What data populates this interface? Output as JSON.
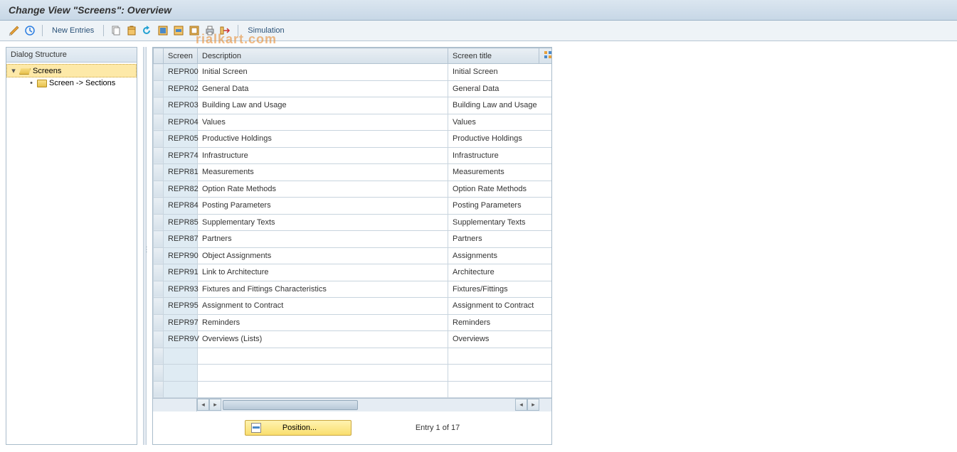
{
  "header": {
    "title": "Change View \"Screens\": Overview"
  },
  "toolbar": {
    "new_entries": "New Entries",
    "simulation": "Simulation"
  },
  "tree": {
    "header": "Dialog Structure",
    "items": [
      {
        "label": "Screens",
        "expanded": true,
        "selected": true,
        "icon": "folder-open"
      },
      {
        "label": "Screen -> Sections",
        "expanded": false,
        "selected": false,
        "icon": "folder-closed",
        "child": true
      }
    ]
  },
  "table": {
    "columns": [
      "Screen",
      "Description",
      "Screen title"
    ],
    "rows": [
      {
        "screen": "REPR00",
        "desc": "Initial Screen",
        "title": "Initial Screen"
      },
      {
        "screen": "REPR02",
        "desc": "General Data",
        "title": "General Data"
      },
      {
        "screen": "REPR03",
        "desc": "Building Law and Usage",
        "title": "Building Law and Usage"
      },
      {
        "screen": "REPR04",
        "desc": "Values",
        "title": "Values"
      },
      {
        "screen": "REPR05",
        "desc": "Productive Holdings",
        "title": "Productive Holdings"
      },
      {
        "screen": "REPR74",
        "desc": "Infrastructure",
        "title": "Infrastructure"
      },
      {
        "screen": "REPR81",
        "desc": "Measurements",
        "title": "Measurements"
      },
      {
        "screen": "REPR82",
        "desc": "Option Rate Methods",
        "title": "Option Rate Methods"
      },
      {
        "screen": "REPR84",
        "desc": "Posting Parameters",
        "title": "Posting Parameters"
      },
      {
        "screen": "REPR85",
        "desc": "Supplementary Texts",
        "title": "Supplementary Texts"
      },
      {
        "screen": "REPR87",
        "desc": "Partners",
        "title": "Partners"
      },
      {
        "screen": "REPR90",
        "desc": "Object Assignments",
        "title": "Assignments"
      },
      {
        "screen": "REPR91",
        "desc": "Link to Architecture",
        "title": "Architecture"
      },
      {
        "screen": "REPR93",
        "desc": "Fixtures and Fittings Characteristics",
        "title": "Fixtures/Fittings"
      },
      {
        "screen": "REPR95",
        "desc": "Assignment to Contract",
        "title": "Assignment to Contract"
      },
      {
        "screen": "REPR97",
        "desc": "Reminders",
        "title": "Reminders"
      },
      {
        "screen": "REPR9V",
        "desc": "Overviews (Lists)",
        "title": "Overviews"
      }
    ],
    "empty_rows": 3
  },
  "footer": {
    "position_label": "Position...",
    "entry_text": "Entry 1 of 17"
  },
  "watermark": "rialkart.com"
}
